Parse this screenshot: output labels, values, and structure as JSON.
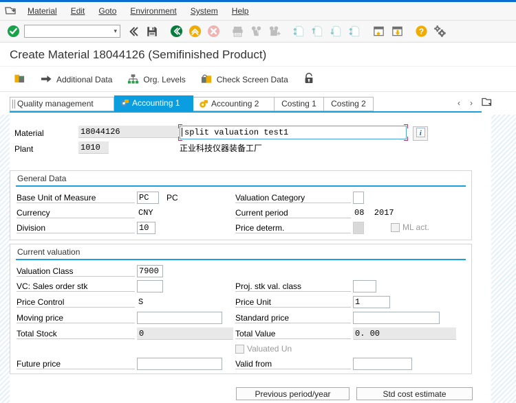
{
  "window": {
    "title": "Create Material 18044126 (Semifinished Product)"
  },
  "menubar": {
    "system_icon": "session-icon",
    "items": [
      {
        "label": "Material"
      },
      {
        "label": "Edit"
      },
      {
        "label": "Goto"
      },
      {
        "label": "Environment"
      },
      {
        "label": "System"
      },
      {
        "label": "Help"
      }
    ]
  },
  "toolbar": {
    "command_field_value": "",
    "command_field_placeholder": "",
    "buttons": [
      {
        "name": "enter-check-icon",
        "title": "Continue (Enter)"
      },
      {
        "name": "previous-screen-icon",
        "title": "Back"
      },
      {
        "name": "save-icon",
        "title": "Save"
      },
      {
        "name": "back-green-icon",
        "title": "Back"
      },
      {
        "name": "exit-yellow-icon",
        "title": "Exit"
      },
      {
        "name": "cancel-red-icon",
        "title": "Cancel"
      },
      {
        "name": "print-icon",
        "title": "Print"
      },
      {
        "name": "find-icon",
        "title": "Find"
      },
      {
        "name": "find-next-icon",
        "title": "Find Next"
      },
      {
        "name": "first-page-icon",
        "title": "First Page"
      },
      {
        "name": "previous-page-icon",
        "title": "Previous Page"
      },
      {
        "name": "next-page-icon",
        "title": "Next Page"
      },
      {
        "name": "last-page-icon",
        "title": "Last Page"
      },
      {
        "name": "create-session-icon",
        "title": "Create New Session"
      },
      {
        "name": "create-shortcut-icon",
        "title": "Create Shortcut"
      },
      {
        "name": "help-icon",
        "title": "Help"
      },
      {
        "name": "customize-local-layout-icon",
        "title": "Customizing of Local Layout"
      }
    ]
  },
  "apptoolbar": {
    "buttons": [
      {
        "name": "additional-data-icon-only",
        "label": "",
        "icon": "material-card-icon"
      },
      {
        "name": "additional-data-button",
        "label": "Additional Data",
        "icon": "arrow-right-icon"
      },
      {
        "name": "org-levels-button",
        "label": "Org. Levels",
        "icon": "org-hierarchy-icon"
      },
      {
        "name": "check-screen-data-button",
        "label": "Check Screen Data",
        "icon": "check-screen-icon"
      },
      {
        "name": "lock-button",
        "label": "",
        "icon": "lock-icon"
      }
    ]
  },
  "tabs": {
    "items": [
      {
        "label": "Quality management",
        "active": false,
        "icon": ""
      },
      {
        "label": "Accounting 1",
        "active": true,
        "icon": "accounting-icon"
      },
      {
        "label": "Accounting 2",
        "active": false,
        "icon": "costing-icon"
      },
      {
        "label": "Costing 1",
        "active": false,
        "icon": ""
      },
      {
        "label": "Costing 2",
        "active": false,
        "icon": ""
      }
    ],
    "scroll_left": "‹",
    "scroll_right": "›",
    "tab_list_icon": "tab-list-icon"
  },
  "header": {
    "material_label": "Material",
    "material_value": "18044126",
    "description_value": "split valuation test1",
    "info_icon": "info-icon",
    "plant_label": "Plant",
    "plant_value": "1010",
    "plant_name": "正业科技仪器装备工厂"
  },
  "general_data": {
    "title": "General Data",
    "fields": [
      {
        "label": "Base Unit of Measure",
        "value": "PC",
        "suffix": "PC"
      },
      {
        "label": "Currency",
        "value": "CNY",
        "suffix": ""
      },
      {
        "label": "Division",
        "value": "10",
        "suffix": ""
      },
      {
        "label": "Valuation Category",
        "value": "",
        "suffix": ""
      },
      {
        "label": "Current period",
        "value": "08  2017",
        "suffix": ""
      },
      {
        "label": "Price determ.",
        "value": "",
        "suffix": ""
      }
    ],
    "ml_active_label": "ML act.",
    "ml_active_checked": false
  },
  "current_valuation": {
    "title": "Current valuation",
    "fields": [
      {
        "label": "Valuation Class",
        "value": "7900"
      },
      {
        "label": "VC: Sales order stk",
        "value": ""
      },
      {
        "label": "Price Control",
        "value": "S"
      },
      {
        "label": "Moving price",
        "value": ""
      },
      {
        "label": "Total Stock",
        "value": "0"
      },
      {
        "label": "Future price",
        "value": ""
      },
      {
        "label": "Proj. stk val. class",
        "value": ""
      },
      {
        "label": "Price Unit",
        "value": "1"
      },
      {
        "label": "Standard price",
        "value": ""
      },
      {
        "label": "Total Value",
        "value": "0. 00"
      },
      {
        "label": "Valid from",
        "value": ""
      }
    ],
    "valuated_un_label": "Valuated Un",
    "valuated_un_checked": false
  },
  "footer": {
    "previous_period_button": "Previous period/year",
    "std_cost_estimate_button": "Std cost estimate"
  },
  "colors": {
    "accent": "#0a6ed1",
    "tab_active": "#0a9de0",
    "group_rule": "#1ba0db",
    "focus_bracket": "#b03060"
  }
}
